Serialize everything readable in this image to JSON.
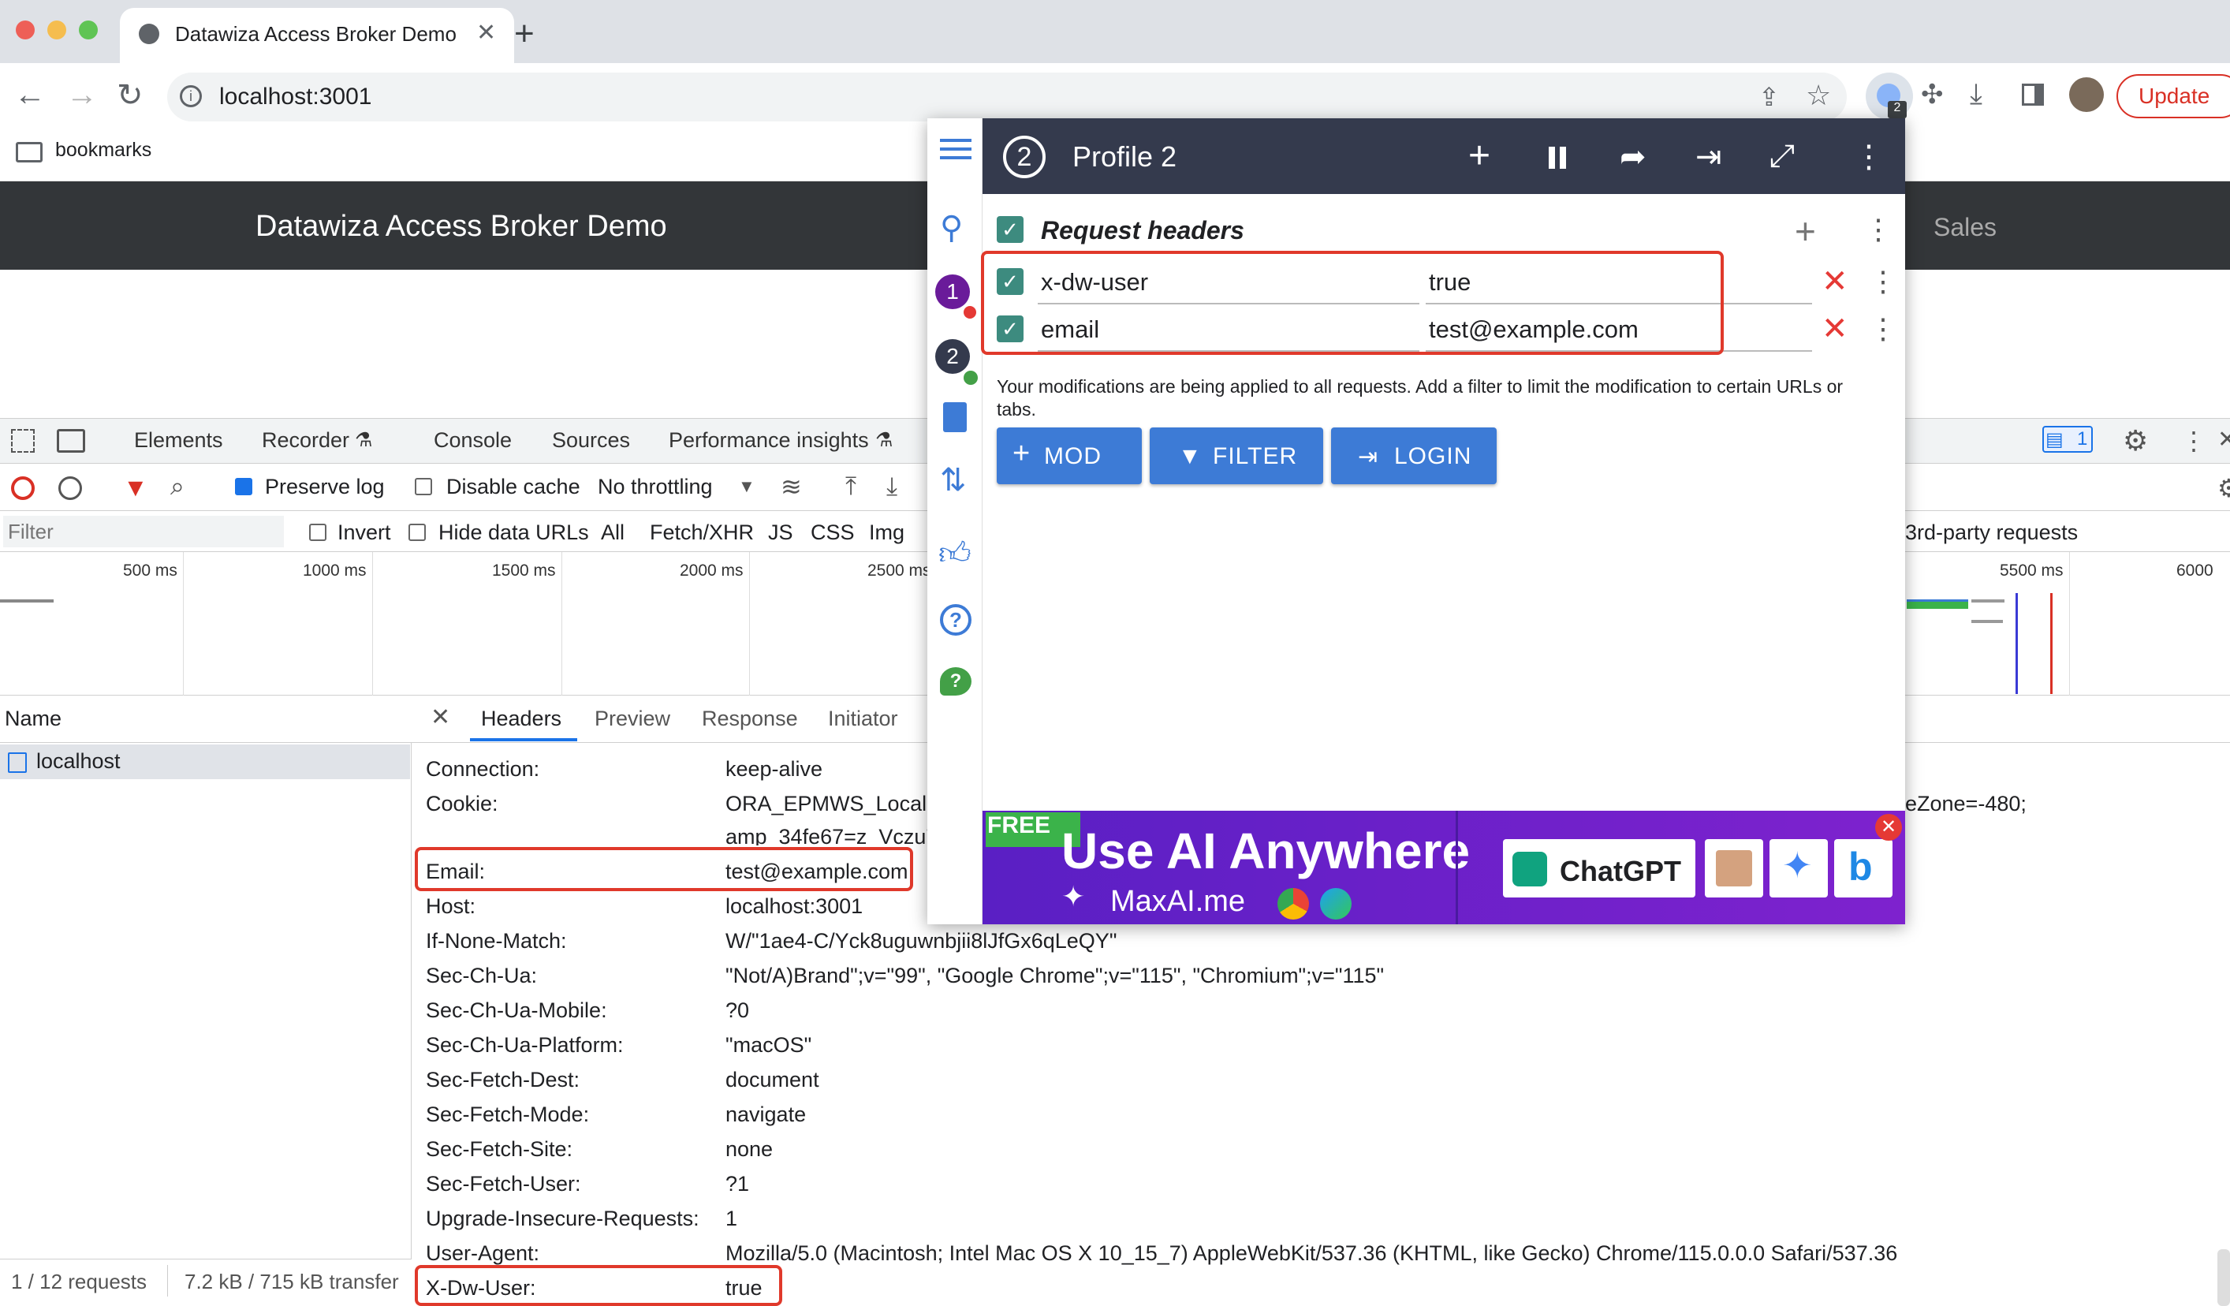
{
  "browser": {
    "tab_title": "Datawiza Access Broker Demo",
    "url": "localhost:3001",
    "bookmarks_label": "bookmarks",
    "update_label": "Update",
    "extension_badge": "2"
  },
  "page": {
    "title": "Datawiza Access Broker Demo",
    "nav_right": "Sales"
  },
  "devtools": {
    "tabs": [
      "Elements",
      "Recorder",
      "Console",
      "Sources",
      "Performance insights"
    ],
    "issues_count": "1",
    "preserve_log": "Preserve log",
    "disable_cache": "Disable cache",
    "throttling": "No throttling",
    "filter_placeholder": "Filter",
    "invert": "Invert",
    "hide_data_urls": "Hide data URLs",
    "filter_types": [
      "All",
      "Fetch/XHR",
      "JS",
      "CSS",
      "Img"
    ],
    "third_party": "3rd-party requests",
    "timeline_ticks": [
      "500 ms",
      "1000 ms",
      "1500 ms",
      "2000 ms",
      "2500 ms",
      "5500 ms",
      "6000"
    ],
    "name_header": "Name",
    "request_name": "localhost",
    "status": "1 / 12 requests",
    "transfer": "7.2 kB / 715 kB transfer",
    "detail_tabs": [
      "Headers",
      "Preview",
      "Response",
      "Initiator"
    ],
    "headers": [
      {
        "k": "Connection:",
        "v": "keep-alive"
      },
      {
        "k": "Cookie:",
        "v": "ORA_EPMWS_Locale"
      },
      {
        "k": "",
        "v": "amp_34fe67=z_Vczu7"
      },
      {
        "k": "Email:",
        "v": "test@example.com"
      },
      {
        "k": "Host:",
        "v": "localhost:3001"
      },
      {
        "k": "If-None-Match:",
        "v": "W/\"1ae4-C/Yck8uguwnbjii8lJfGx6qLeQY\""
      },
      {
        "k": "Sec-Ch-Ua:",
        "v": "\"Not/A)Brand\";v=\"99\", \"Google Chrome\";v=\"115\", \"Chromium\";v=\"115\""
      },
      {
        "k": "Sec-Ch-Ua-Mobile:",
        "v": "?0"
      },
      {
        "k": "Sec-Ch-Ua-Platform:",
        "v": "\"macOS\""
      },
      {
        "k": "Sec-Fetch-Dest:",
        "v": "document"
      },
      {
        "k": "Sec-Fetch-Mode:",
        "v": "navigate"
      },
      {
        "k": "Sec-Fetch-Site:",
        "v": "none"
      },
      {
        "k": "Sec-Fetch-User:",
        "v": "?1"
      },
      {
        "k": "Upgrade-Insecure-Requests:",
        "v": "1"
      },
      {
        "k": "User-Agent:",
        "v": "Mozilla/5.0 (Macintosh; Intel Mac OS X 10_15_7) AppleWebKit/537.36 (KHTML, like Gecko) Chrome/115.0.0.0 Safari/537.36"
      },
      {
        "k": "X-Dw-User:",
        "v": "true"
      }
    ],
    "cookie_tail": "eZone=-480;"
  },
  "modheader": {
    "profile_number": "2",
    "profile_title": "Profile 2",
    "section_title": "Request headers",
    "rows": [
      {
        "name": "x-dw-user",
        "value": "true"
      },
      {
        "name": "email",
        "value": "test@example.com"
      }
    ],
    "note": "Your modifications are being applied to all requests. Add a filter to limit the modification to certain URLs or tabs.",
    "btn_mod": "MOD",
    "btn_filter": "FILTER",
    "btn_login": "LOGIN",
    "profiles": [
      "1",
      "2"
    ]
  },
  "ad": {
    "free": "FREE",
    "headline": "Use AI Anywhere",
    "site": "MaxAI.me",
    "chatgpt": "ChatGPT"
  }
}
